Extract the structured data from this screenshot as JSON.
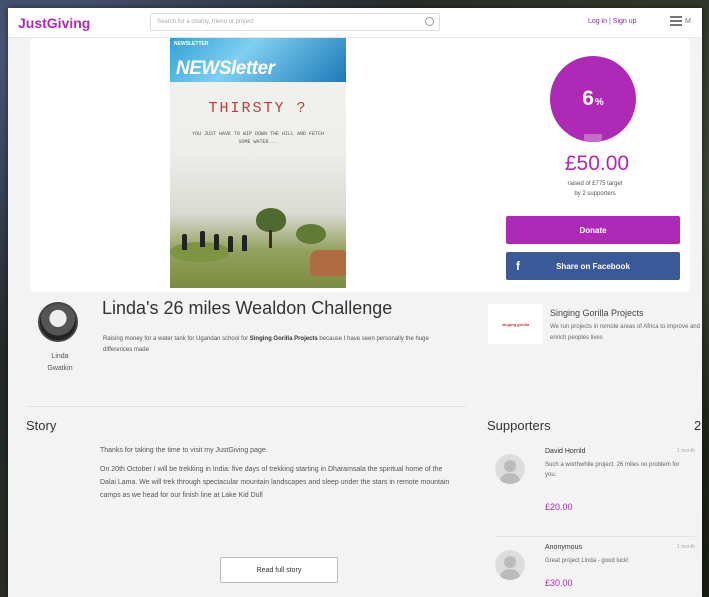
{
  "header": {
    "logo": "JustGiving",
    "search_placeholder": "Search for a charity, friend or project",
    "login_label": "Log in  |  Sign up",
    "menu_label": "M"
  },
  "cover": {
    "top_text": "NEWSLETTER",
    "newsletter": "NEWSletter",
    "headline": "THIRSTY ?",
    "subtext": "YOU JUST HAVE TO WIP DOWN THE HILL AND FETCH SOME WATER..."
  },
  "progress": {
    "percent": "6",
    "percent_sign": "%",
    "percent_value": 6,
    "amount": "£50.00",
    "raised_line1": "raised of £775 target",
    "raised_line2": "by 2 supporters"
  },
  "buttons": {
    "donate": "Donate",
    "facebook": "Share on Facebook",
    "facebook_icon": "f",
    "read_more": "Read full story"
  },
  "fundraiser": {
    "owner_first": "Linda",
    "owner_last": "Gwatkin",
    "title": "Linda's 26 miles Wealdon Challenge",
    "summary_pre": "Raising money for a water tank for Ugandan school for ",
    "summary_charity": "Singing Gorilla Projects",
    "summary_post": " because I have seen personally the huge differences made"
  },
  "charity": {
    "logo_text": "singing gorilla",
    "name": "Singing Gorilla Projects",
    "description": "We run projects in remote areas of Africa to improve and enrich peoples lives"
  },
  "story": {
    "heading": "Story",
    "p1": "Thanks for taking the time to visit my JustGiving page.",
    "p2": "On 20th October I will be trekking in India: five days of trekking starting in Dharamsala the spiritual home of the Dalai Lama. We will trek through spectacular mountain landscapes and sleep under the stars in remote mountain camps as we head for our finish line at Lake Kid Dull"
  },
  "supporters": {
    "heading": "Supporters",
    "count": "2",
    "items": [
      {
        "name": "David Hornld",
        "time": "1 month",
        "message": "Such a worthwhile project. 26 miles no problem for you.",
        "amount": "£20.00"
      },
      {
        "name": "Anonymous",
        "time": "1 month",
        "message": "Great project Linda - good luck!",
        "amount": "£30.00"
      }
    ]
  },
  "colors": {
    "brand": "#ad29b6",
    "facebook": "#3b5998"
  }
}
